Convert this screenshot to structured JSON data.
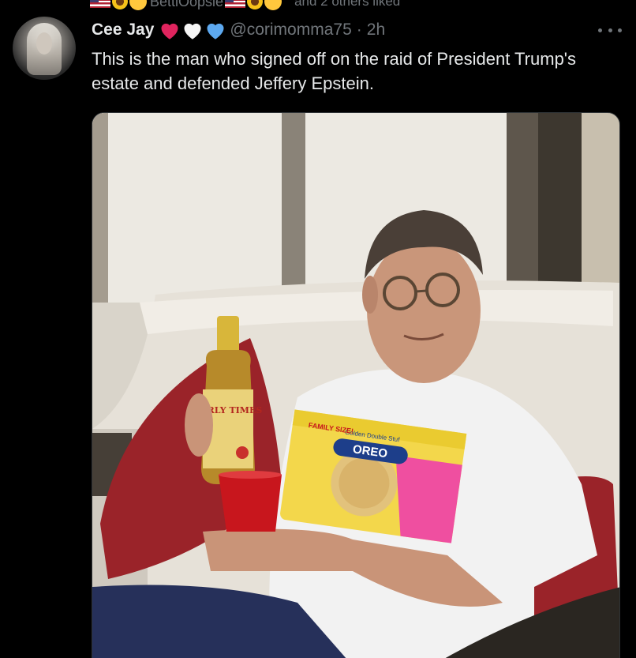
{
  "social_context": {
    "name": "BettiOopsie",
    "others": "and 2 others liked"
  },
  "tweet": {
    "display_name": "Cee Jay",
    "name_emojis": [
      "red-heart",
      "white-heart",
      "blue-heart"
    ],
    "handle": "@corimomma75",
    "separator": "·",
    "time": "2h",
    "text": "This is the man who signed off on the raid of President Trump's estate and defended Jeffery Epstein."
  },
  "media": {
    "bottle_label": "EARLY TIMES",
    "cookie_brand": "OREO",
    "cookie_sub": "Golden Double Stuf",
    "package_badge": "FAMILY SIZE!"
  },
  "colors": {
    "background": "#000000",
    "text": "#e7e9ea",
    "muted": "#71767b",
    "heart_red": "#f91880",
    "heart_blue": "#5da9f0"
  }
}
